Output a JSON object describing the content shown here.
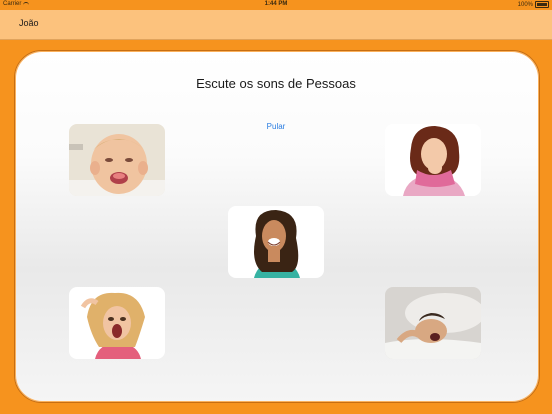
{
  "status_bar": {
    "carrier": "Carrier",
    "time": "1:44 PM",
    "battery": "100%"
  },
  "nav": {
    "user_name": "João"
  },
  "main": {
    "title": "Escute os sons de Pessoas",
    "skip_label": "Pular"
  },
  "colors": {
    "accent": "#f6931e",
    "nav_background": "#fcc27d",
    "link": "#2a7de1"
  }
}
